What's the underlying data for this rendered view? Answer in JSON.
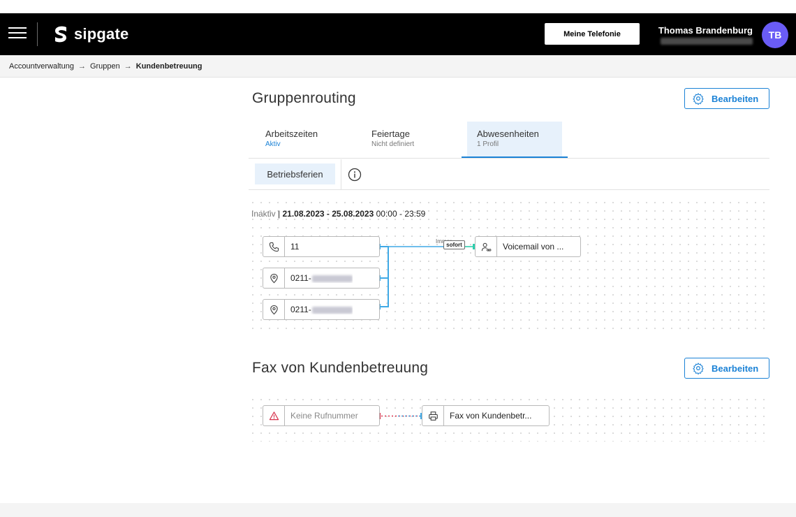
{
  "header": {
    "logo_text": "sipgate",
    "phone_button": "Meine Telefonie",
    "user_name": "Thomas Brandenburg",
    "avatar_initials": "TB",
    "accent_color": "#6a5cf6"
  },
  "breadcrumb": {
    "items": [
      "Accountverwaltung",
      "Gruppen"
    ],
    "current": "Kundenbetreuung",
    "separator": "→"
  },
  "routing": {
    "title": "Gruppenrouting",
    "edit_label": "Bearbeiten",
    "tabs": [
      {
        "label": "Arbeitszeiten",
        "sub": "Aktiv"
      },
      {
        "label": "Feiertage",
        "sub": "Nicht definiert"
      },
      {
        "label": "Abwesenheiten",
        "sub": "1 Profil"
      }
    ],
    "profile_chip": "Betriebsferien",
    "status": {
      "state": "Inaktiv",
      "separator": "|",
      "dates": "21.08.2023 - 25.08.2023",
      "times": "00:00 - 23:59"
    },
    "sources": [
      {
        "icon": "phone-icon",
        "prefix": "11",
        "blurred": false
      },
      {
        "icon": "location-pin-icon",
        "prefix": "0211-",
        "blurred": true
      },
      {
        "icon": "location-pin-icon",
        "prefix": "0211-",
        "blurred": true
      }
    ],
    "edge_label": "Immer",
    "edge_badge": "sofort",
    "target": {
      "icon": "voicemail-user-icon",
      "label": "Voicemail von ..."
    }
  },
  "fax": {
    "title": "Fax von Kundenbetreuung",
    "edit_label": "Bearbeiten",
    "source": {
      "icon": "warning-icon",
      "label": "Keine Rufnummer"
    },
    "target": {
      "icon": "fax-printer-icon",
      "label": "Fax von Kundenbetr..."
    }
  },
  "colors": {
    "primary": "#1b82d6",
    "connector": "#3fa9e6",
    "connector_active": "#2ecfae",
    "error": "#d6304a",
    "header_bg": "#000000"
  }
}
